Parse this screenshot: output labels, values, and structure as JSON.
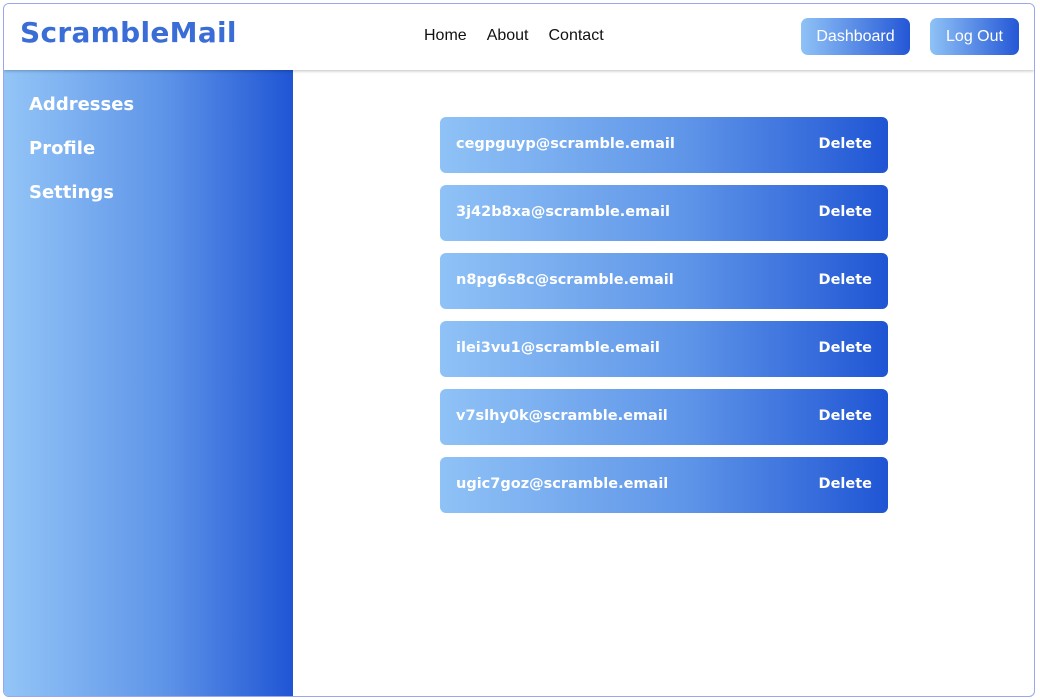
{
  "brand": "ScrambleMail",
  "nav": {
    "home": "Home",
    "about": "About",
    "contact": "Contact"
  },
  "header_buttons": {
    "dashboard": "Dashboard",
    "logout": "Log Out"
  },
  "sidebar": {
    "items": [
      {
        "label": "Addresses"
      },
      {
        "label": "Profile"
      },
      {
        "label": "Settings"
      }
    ]
  },
  "addresses": [
    {
      "email": "cegpguyp@scramble.email",
      "action": "Delete"
    },
    {
      "email": "3j42b8xa@scramble.email",
      "action": "Delete"
    },
    {
      "email": "n8pg6s8c@scramble.email",
      "action": "Delete"
    },
    {
      "email": "ilei3vu1@scramble.email",
      "action": "Delete"
    },
    {
      "email": "v7slhy0k@scramble.email",
      "action": "Delete"
    },
    {
      "email": "ugic7goz@scramble.email",
      "action": "Delete"
    }
  ],
  "colors": {
    "brand": "#3a6ed6",
    "gradient_light": "#8fc2f6",
    "gradient_dark": "#1f55d4"
  }
}
